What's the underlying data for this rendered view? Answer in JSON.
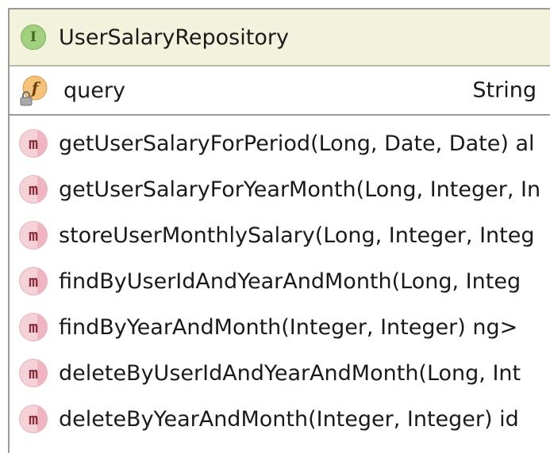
{
  "class": {
    "stereotype_icon": "I",
    "name": "UserSalaryRepository"
  },
  "fields": [
    {
      "icon": "field-icon",
      "icon_letter": "f",
      "name": "query",
      "type": "String"
    }
  ],
  "methods": [
    {
      "icon_letter": "m",
      "signature": "getUserSalaryForPeriod(Long, Date, Date) al"
    },
    {
      "icon_letter": "m",
      "signature": "getUserSalaryForYearMonth(Long, Integer, In"
    },
    {
      "icon_letter": "m",
      "signature": "storeUserMonthlySalary(Long, Integer, Integ"
    },
    {
      "icon_letter": "m",
      "signature": "findByUserIdAndYearAndMonth(Long, Integ"
    },
    {
      "icon_letter": "m",
      "signature": "findByYearAndMonth(Integer, Integer) ng>"
    },
    {
      "icon_letter": "m",
      "signature": "deleteByUserIdAndYearAndMonth(Long, Int"
    },
    {
      "icon_letter": "m",
      "signature": "deleteByYearAndMonth(Integer, Integer) id"
    }
  ]
}
